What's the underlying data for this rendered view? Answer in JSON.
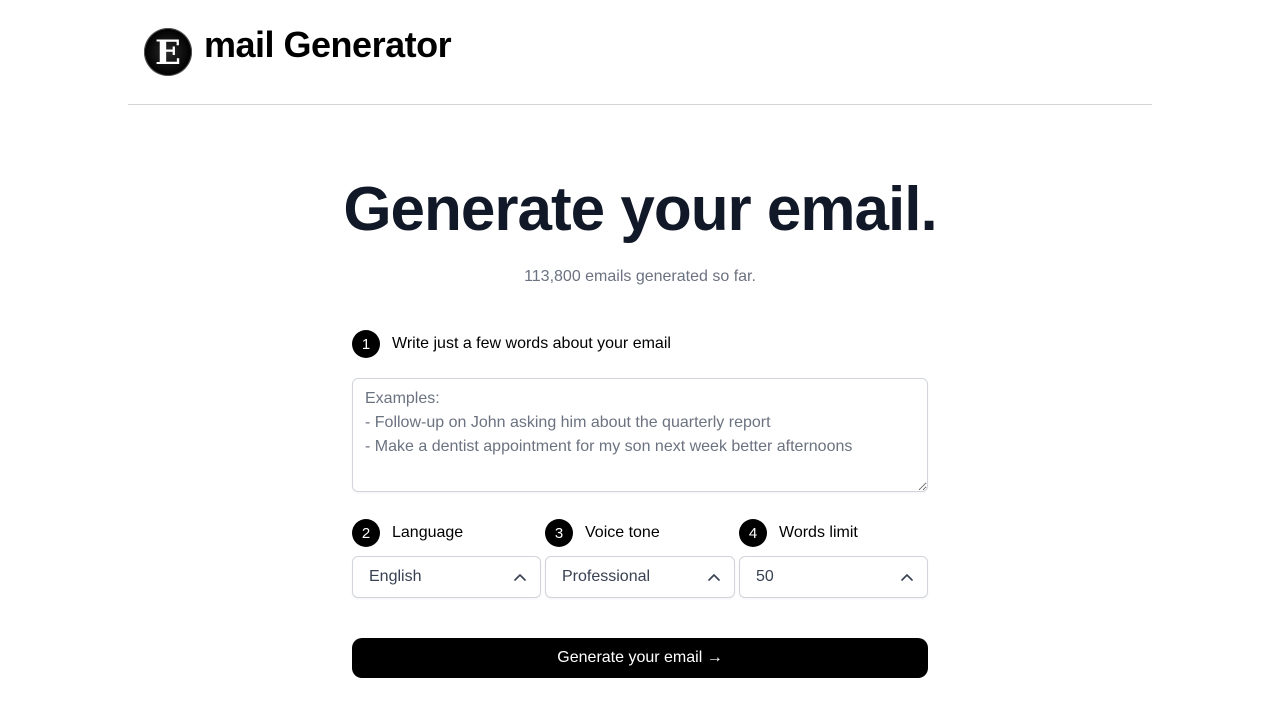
{
  "header": {
    "logo_letter": "E",
    "title": "mail Generator"
  },
  "hero": {
    "title": "Generate your email.",
    "counter": "113,800 emails generated so far."
  },
  "steps": [
    {
      "number": "1",
      "label": "Write just a few words about your email"
    },
    {
      "number": "2",
      "label": "Language"
    },
    {
      "number": "3",
      "label": "Voice tone"
    },
    {
      "number": "4",
      "label": "Words limit"
    }
  ],
  "prompt": {
    "value": "",
    "placeholder": "Examples:\n- Follow-up on John asking him about the quarterly report\n- Make a dentist appointment for my son next week better afternoons"
  },
  "selects": {
    "language": "English",
    "voice_tone": "Professional",
    "words_limit": "50"
  },
  "icons": {
    "select_indicator": "chevron-up-icon"
  },
  "generate_button": {
    "label": "Generate your email →"
  },
  "colors": {
    "primary": "#000000",
    "heading": "#111827",
    "muted": "#6b7280",
    "border": "#d1d5db"
  }
}
